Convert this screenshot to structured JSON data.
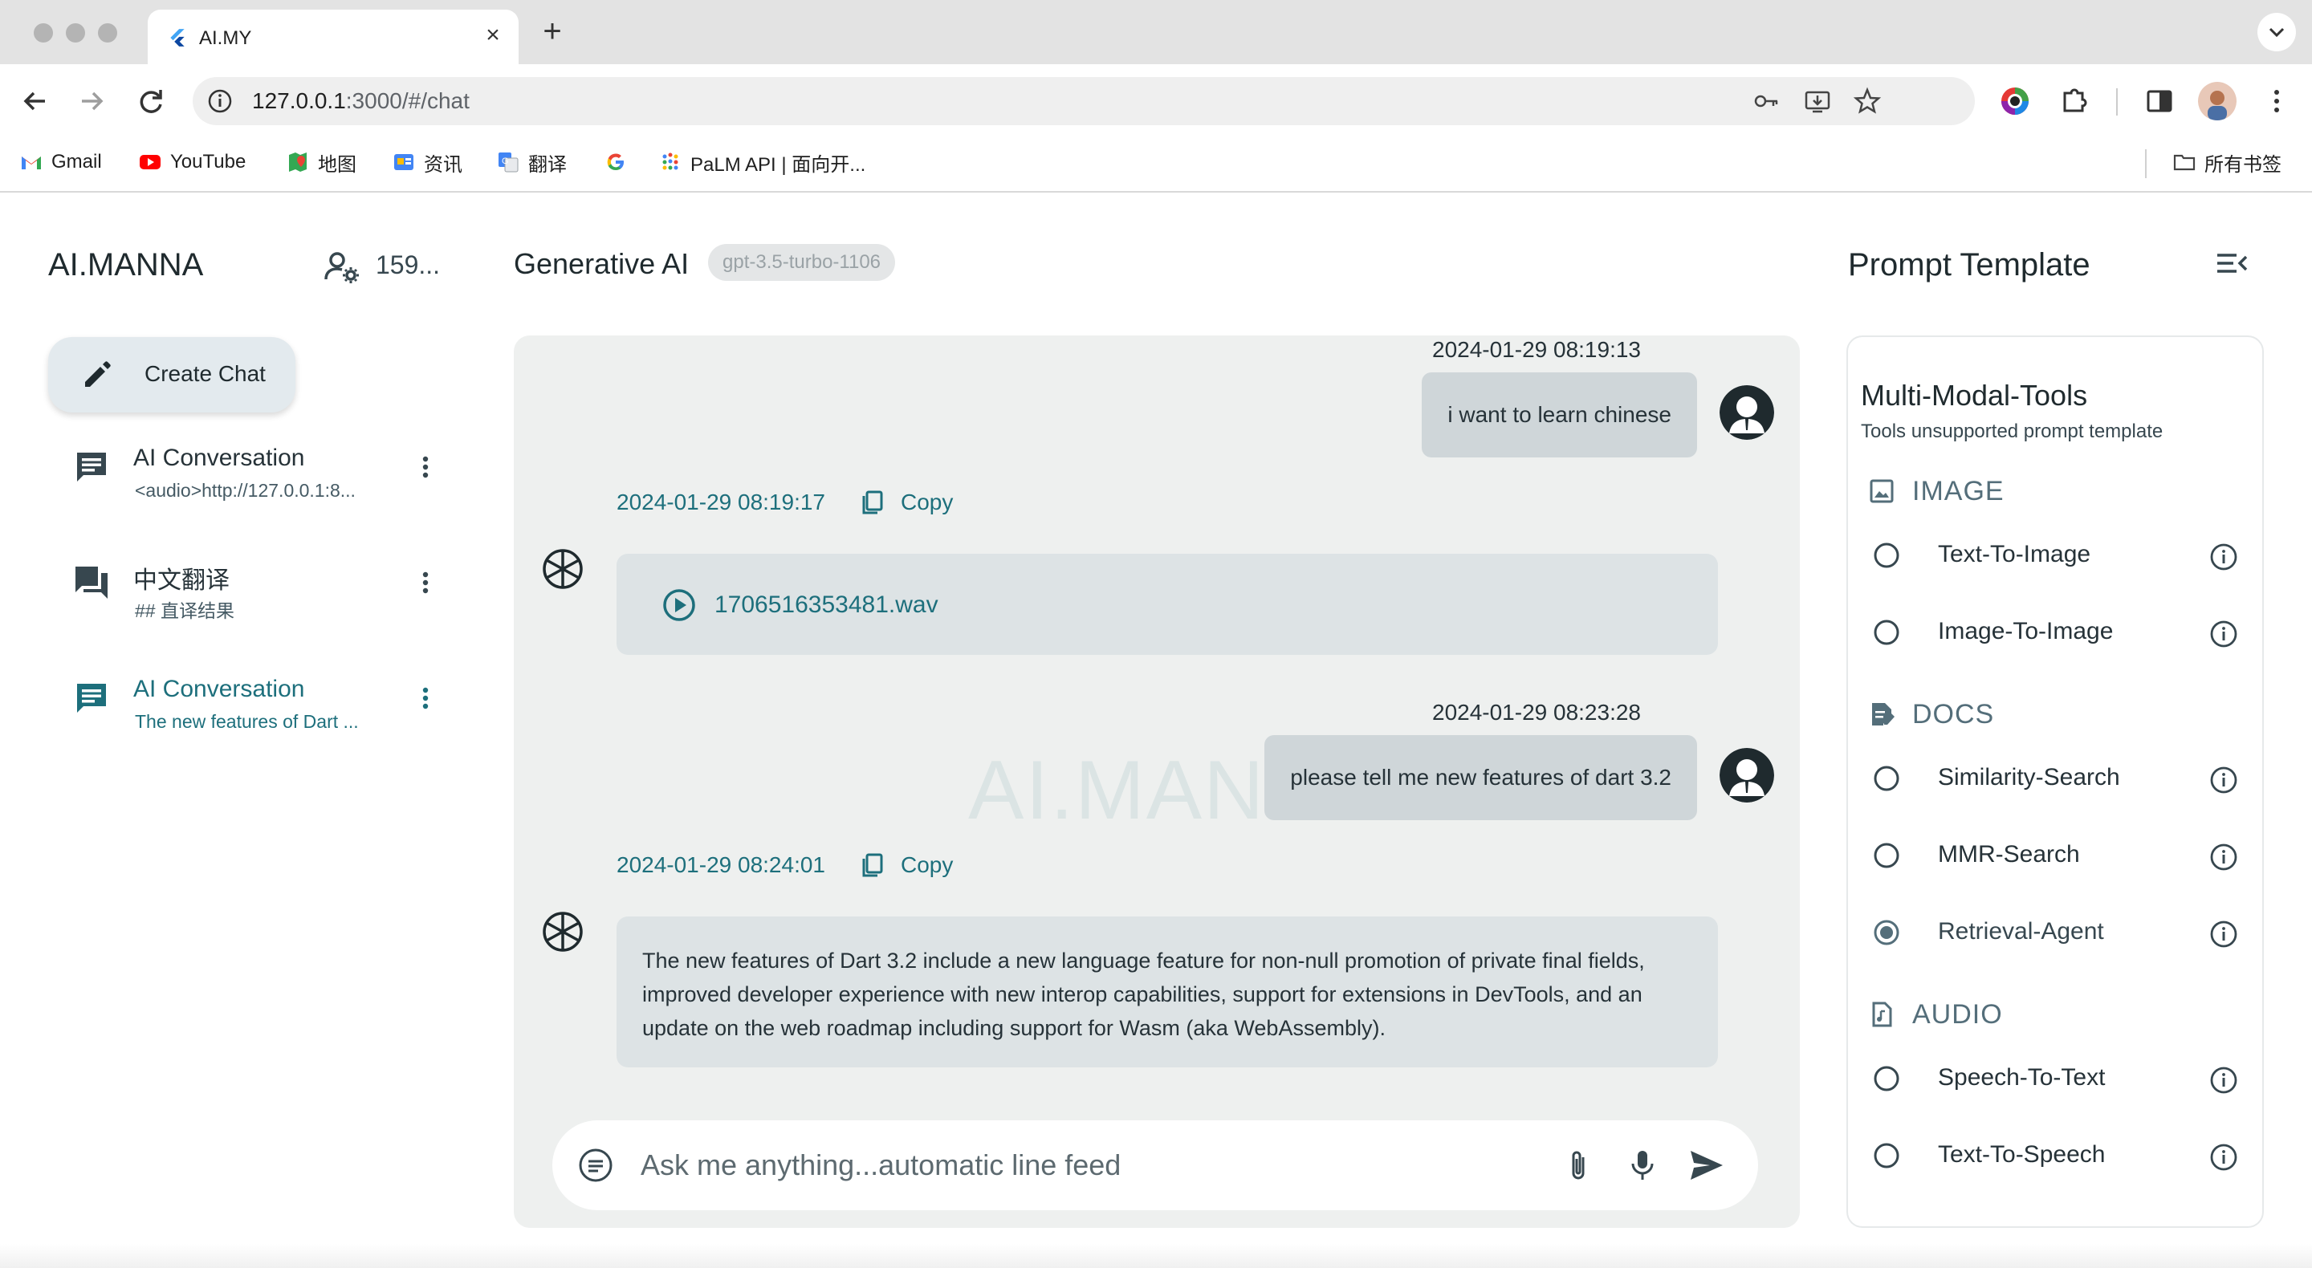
{
  "browser": {
    "tab_title": "AI.MY",
    "url_host": "127.0.0.1",
    "url_rest": ":3000/#/chat",
    "bookmarks": [
      {
        "label": "Gmail",
        "icon": "gmail-icon"
      },
      {
        "label": "YouTube",
        "icon": "youtube-icon"
      },
      {
        "label": "地图",
        "icon": "maps-icon"
      },
      {
        "label": "资讯",
        "icon": "news-icon"
      },
      {
        "label": "翻译",
        "icon": "translate-icon"
      },
      {
        "label": "",
        "icon": "google-icon"
      },
      {
        "label": "PaLM API | 面向开...",
        "icon": "palm-icon"
      }
    ],
    "all_bookmarks": "所有书签"
  },
  "sidebar": {
    "brand": "AI.MANNA",
    "user_count": "159...",
    "create_chat": "Create Chat",
    "conversations": [
      {
        "title": "AI Conversation",
        "subtitle": "<audio>http://127.0.0.1:8...",
        "icon": "chat-icon",
        "active": false
      },
      {
        "title": "中文翻译",
        "subtitle": "## 直译结果",
        "icon": "forum-icon",
        "active": false
      },
      {
        "title": "AI Conversation",
        "subtitle": "The new features of Dart ...",
        "icon": "chat-icon",
        "active": true
      }
    ]
  },
  "main": {
    "title": "Generative AI",
    "model": "gpt-3.5-turbo-1106",
    "watermark": "AI.MANNA",
    "messages": [
      {
        "role": "user",
        "time": "2024-01-29 08:19:13",
        "text": "i want to learn chinese"
      },
      {
        "role": "ai",
        "time": "2024-01-29 08:19:17",
        "copy_label": "Copy",
        "audio_file": "1706516353481.wav"
      },
      {
        "role": "user",
        "time": "2024-01-29 08:23:28",
        "text": "please tell me new features of dart 3.2"
      },
      {
        "role": "ai",
        "time": "2024-01-29 08:24:01",
        "copy_label": "Copy",
        "text": "The new features of Dart 3.2 include a new language feature for non-null promotion of private final fields, improved developer experience with new interop capabilities, support for extensions in DevTools, and an update on the web roadmap including support for Wasm (aka WebAssembly)."
      }
    ],
    "input_placeholder": "Ask me anything...automatic line feed"
  },
  "prompt_template": {
    "title": "Prompt Template",
    "heading": "Multi-Modal-Tools",
    "subtitle": "Tools unsupported prompt template",
    "sections": [
      {
        "label": "IMAGE",
        "icon": "image-icon",
        "options": [
          {
            "label": "Text-To-Image",
            "selected": false
          },
          {
            "label": "Image-To-Image",
            "selected": false
          }
        ]
      },
      {
        "label": "DOCS",
        "icon": "document-icon",
        "options": [
          {
            "label": "Similarity-Search",
            "selected": false
          },
          {
            "label": "MMR-Search",
            "selected": false
          },
          {
            "label": "Retrieval-Agent",
            "selected": true
          }
        ]
      },
      {
        "label": "AUDIO",
        "icon": "audio-file-icon",
        "options": [
          {
            "label": "Speech-To-Text",
            "selected": false
          },
          {
            "label": "Text-To-Speech",
            "selected": false
          }
        ]
      }
    ]
  },
  "colors": {
    "accent": "#1d6f7c",
    "panel_bg": "#eef0ef",
    "bubble_user": "#cfd6d9",
    "bubble_ai": "#dde3e5"
  }
}
